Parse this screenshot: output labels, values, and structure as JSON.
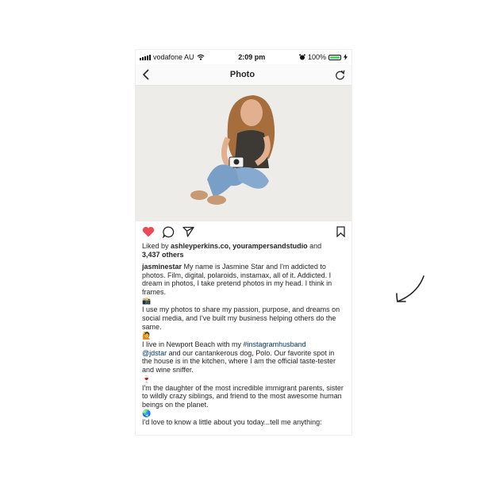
{
  "statusbar": {
    "carrier": "vodafone AU",
    "time": "2:09 pm",
    "battery": "100%"
  },
  "nav": {
    "title": "Photo"
  },
  "post": {
    "liked_by_prefix": "Liked by ",
    "liked_by_users": "ashleyperkins.co, yourampersandstudio",
    "liked_by_and": " and",
    "likes_count": "3,437 others",
    "username": "jasminestar",
    "p1": " My name is Jasmine Star and I'm addicted to photos. Film, digital, polaroids, instamax, all of it.  Addicted. I dream in photos, I take pretend photos in my head. I think in frames.",
    "emoji1": "📸",
    "p2": "I use my photos to share my passion, purpose, and dreams on social media, and I've built my business helping others do the same.",
    "emoji2": "🙋",
    "p3_a": "I live in Newport Beach with my ",
    "p3_tag1": "#instagramhusband",
    "p3_tag2": "@jdstar",
    "p3_b": " and our cantankerous dog, Polo.  Our favorite spot in the house is in the kitchen, where I am the official taste-tester and wine sniffer.",
    "emoji3": "🍷",
    "p4": "I'm the daughter of the most incredible immigrant parents, sister to wildly crazy siblings, and friend to the most awesome human beings on the planet.",
    "emoji4": "🌏",
    "p5": "I'd love to know a little about you today...tell me anything:"
  },
  "colors": {
    "like_heart": "#ed4956",
    "link": "#003569",
    "battery_green": "#4cd964"
  },
  "icons": [
    "signal-icon",
    "wifi-icon",
    "alarm-icon",
    "battery-icon",
    "charging-icon",
    "back-chevron-icon",
    "refresh-icon",
    "heart-icon",
    "comment-icon",
    "share-icon",
    "bookmark-icon",
    "hand-drawn-arrow-icon"
  ]
}
